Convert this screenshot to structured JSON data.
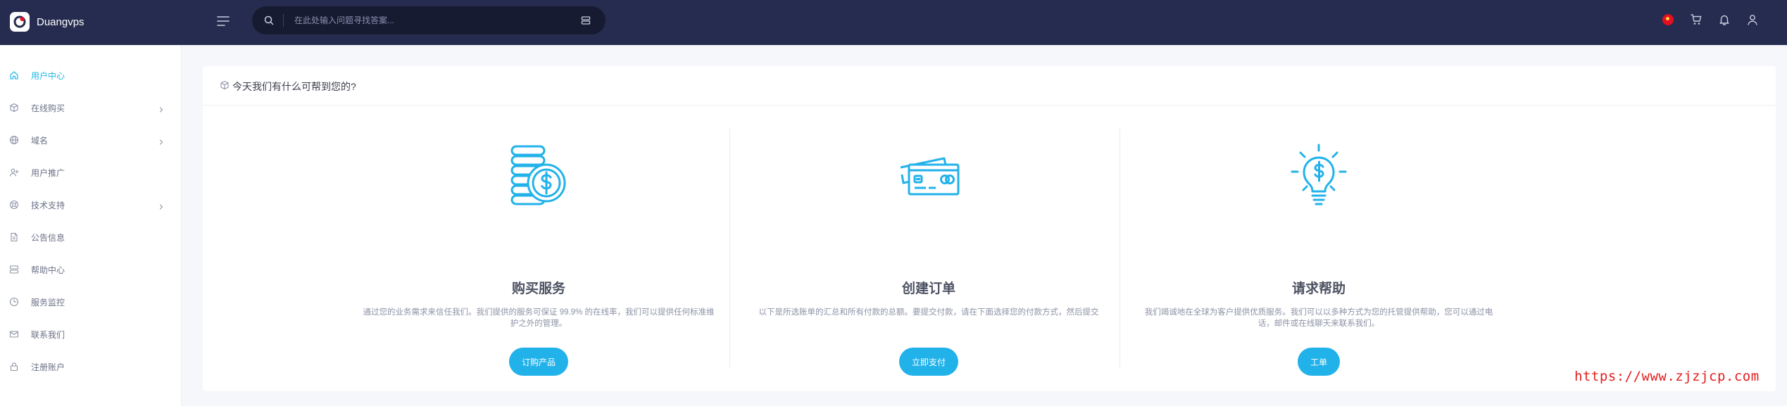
{
  "header": {
    "brand": "Duangvps",
    "search": {
      "placeholder": "在此处输入问题寻找答案..."
    },
    "icons": [
      "menu-icon",
      "search-icon",
      "filter-icon",
      "flag-icon",
      "cart-icon",
      "bell-icon",
      "user-icon"
    ]
  },
  "sidebar": {
    "items": [
      {
        "label": "用户中心",
        "icon": "home-icon",
        "active": true,
        "has_children": false
      },
      {
        "label": "在线购买",
        "icon": "box-icon",
        "active": false,
        "has_children": true
      },
      {
        "label": "域名",
        "icon": "globe-icon",
        "active": false,
        "has_children": true
      },
      {
        "label": "用户推广",
        "icon": "user-plus-icon",
        "active": false,
        "has_children": false
      },
      {
        "label": "技术支持",
        "icon": "lifebuoy-icon",
        "active": false,
        "has_children": true
      },
      {
        "label": "公告信息",
        "icon": "document-icon",
        "active": false,
        "has_children": false
      },
      {
        "label": "帮助中心",
        "icon": "server-icon",
        "active": false,
        "has_children": false
      },
      {
        "label": "服务监控",
        "icon": "monitor-icon",
        "active": false,
        "has_children": false
      },
      {
        "label": "联系我们",
        "icon": "mail-icon",
        "active": false,
        "has_children": false
      },
      {
        "label": "注册账户",
        "icon": "lock-icon",
        "active": false,
        "has_children": false
      }
    ]
  },
  "main": {
    "title": "今天我们有什么可帮到您的?",
    "columns": [
      {
        "title": "购买服务",
        "description": "通过您的业务需求来信任我们。我们提供的服务可保证 99.9% 的在线率，我们可以提供任何标准维护之外的管理。",
        "button": "订购产品",
        "icon": "coins-dollar-icon"
      },
      {
        "title": "创建订单",
        "description": "以下是所选账单的汇总和所有付款的总额。要提交付款，请在下面选择您的付款方式，然后提交",
        "button": "立即支付",
        "icon": "credit-card-icon"
      },
      {
        "title": "请求帮助",
        "description": "我们竭诚地在全球为客户提供优质服务。我们可以以多种方式为您的托管提供帮助，您可以通过电话，邮件或在线聊天来联系我们。",
        "button": "工单",
        "icon": "lightbulb-dollar-icon"
      }
    ]
  },
  "watermark": "https://www.zjzjcp.com",
  "colors": {
    "topbar": "#252c4f",
    "accent": "#22b8e6",
    "button": "#22b2ea",
    "watermark": "#e31d1d"
  }
}
